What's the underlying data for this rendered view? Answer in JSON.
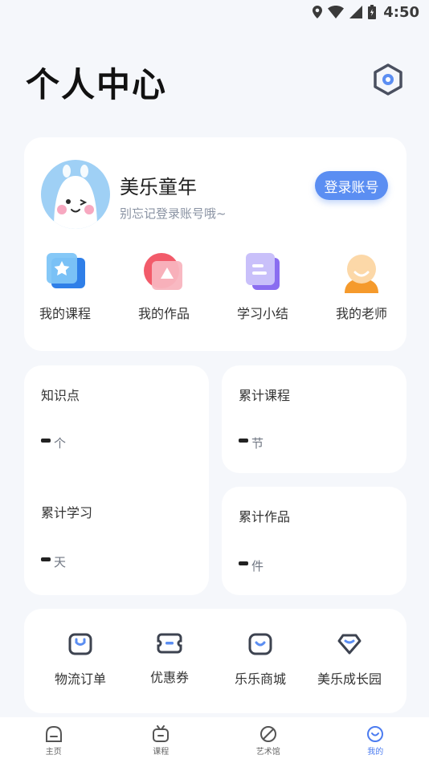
{
  "status_bar": {
    "time": "4:50"
  },
  "header": {
    "title": "个人中心"
  },
  "profile": {
    "name": "美乐童年",
    "subtitle": "别忘记登录账号哦~",
    "login_label": "登录账号"
  },
  "quick_actions": [
    {
      "label": "我的课程",
      "icon": "star-course-icon"
    },
    {
      "label": "我的作品",
      "icon": "triangle-works-icon"
    },
    {
      "label": "学习小结",
      "icon": "notes-summary-icon"
    },
    {
      "label": "我的老师",
      "icon": "teacher-face-icon"
    }
  ],
  "stats": {
    "knowledge": {
      "title": "知识点",
      "value": "",
      "unit": "个"
    },
    "study_days": {
      "title": "累计学习",
      "value": "",
      "unit": "天"
    },
    "courses": {
      "title": "累计课程",
      "value": "",
      "unit": "节"
    },
    "works": {
      "title": "累计作品",
      "value": "",
      "unit": "件"
    }
  },
  "services": [
    {
      "label": "物流订单",
      "icon": "bag-icon"
    },
    {
      "label": "优惠券",
      "icon": "coupon-icon"
    },
    {
      "label": "乐乐商城",
      "icon": "shop-icon"
    },
    {
      "label": "美乐成长园",
      "icon": "diamond-icon"
    }
  ],
  "tabs": [
    {
      "label": "主页",
      "icon": "home-icon",
      "active": false
    },
    {
      "label": "课程",
      "icon": "tv-icon",
      "active": false
    },
    {
      "label": "艺术馆",
      "icon": "leaf-icon",
      "active": false
    },
    {
      "label": "我的",
      "icon": "smile-icon",
      "active": true
    }
  ],
  "colors": {
    "accent": "#5b8ef2",
    "background": "#f5f7fb",
    "card": "#ffffff",
    "tab_active": "#4c7cf0"
  }
}
